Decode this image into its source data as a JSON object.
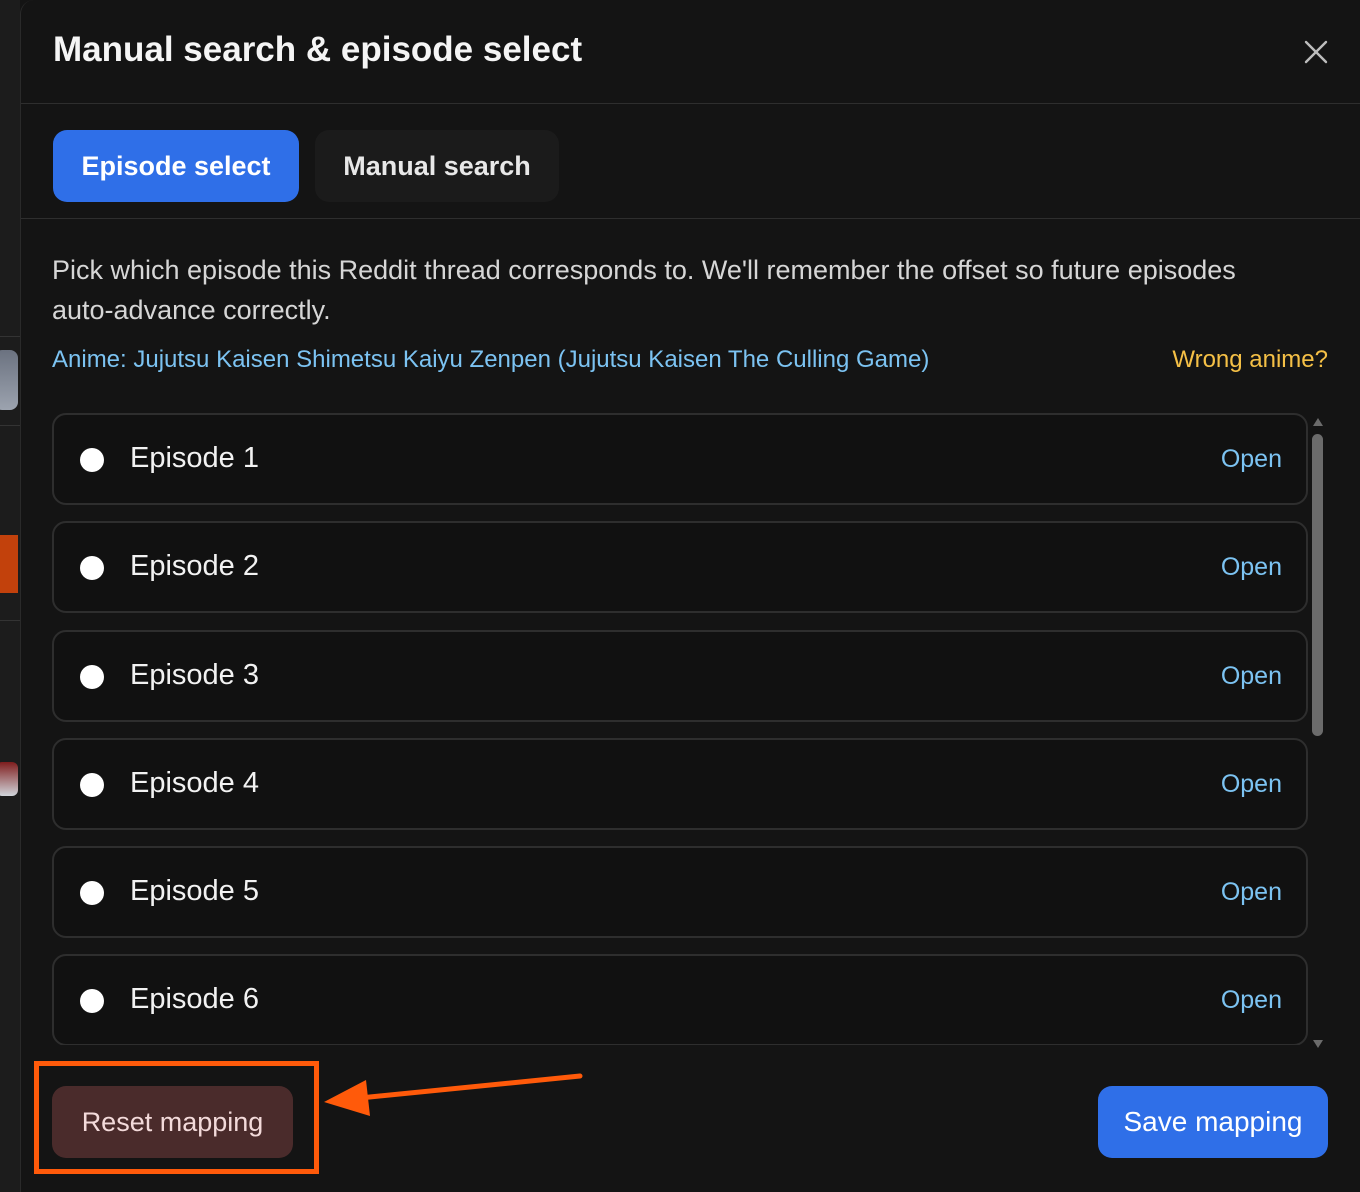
{
  "modal": {
    "title": "Manual search & episode select",
    "close_icon": "close-icon"
  },
  "tabs": [
    {
      "label": "Episode select",
      "active": true
    },
    {
      "label": "Manual search",
      "active": false
    }
  ],
  "description": "Pick which episode this Reddit thread corresponds to. We'll remember the offset so future episodes auto-advance correctly.",
  "anime_link": "Anime: Jujutsu Kaisen Shimetsu Kaiyu Zenpen (Jujutsu Kaisen The Culling Game)",
  "wrong_anime": "Wrong anime?",
  "episodes": [
    {
      "label": "Episode 1",
      "action": "Open"
    },
    {
      "label": "Episode 2",
      "action": "Open"
    },
    {
      "label": "Episode 3",
      "action": "Open"
    },
    {
      "label": "Episode 4",
      "action": "Open"
    },
    {
      "label": "Episode 5",
      "action": "Open"
    },
    {
      "label": "Episode 6",
      "action": "Open"
    }
  ],
  "footer": {
    "reset_label": "Reset mapping",
    "save_label": "Save mapping"
  },
  "colors": {
    "accent_blue": "#2f6fe8",
    "link_blue": "#7cc3f2",
    "warning_yellow": "#f5c046",
    "reset_bg": "#4a2b2b",
    "annotation_orange": "#ff5a0a"
  }
}
